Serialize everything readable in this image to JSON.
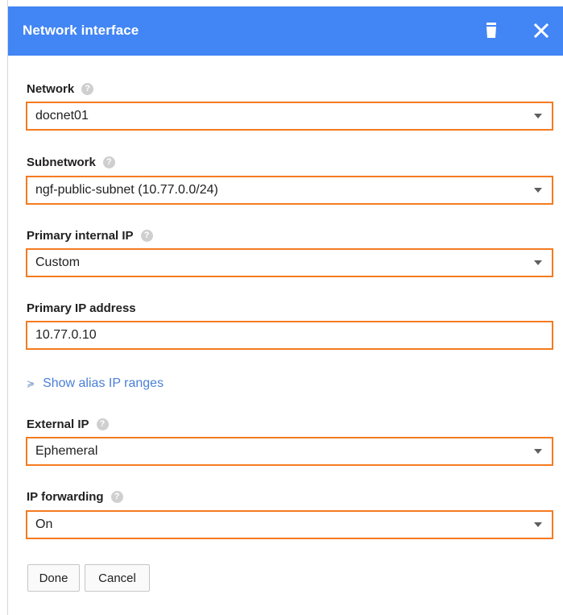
{
  "header": {
    "title": "Network interface"
  },
  "icons": {
    "help": "?"
  },
  "fields": {
    "network": {
      "label": "Network",
      "value": "docnet01"
    },
    "subnetwork": {
      "label": "Subnetwork",
      "value": "ngf-public-subnet (10.77.0.0/24)"
    },
    "primary_internal_ip": {
      "label": "Primary internal IP",
      "value": "Custom"
    },
    "primary_ip_address": {
      "label": "Primary IP address",
      "value": "10.77.0.10"
    },
    "external_ip": {
      "label": "External IP",
      "value": "Ephemeral"
    },
    "ip_forwarding": {
      "label": "IP forwarding",
      "value": "On"
    }
  },
  "alias": {
    "chevron": "≽",
    "label": "Show alias IP ranges"
  },
  "buttons": {
    "done": "Done",
    "cancel": "Cancel"
  },
  "colors": {
    "header_bg": "#4285f4",
    "highlight_border": "#f47b20",
    "link": "#4a7fd6"
  }
}
